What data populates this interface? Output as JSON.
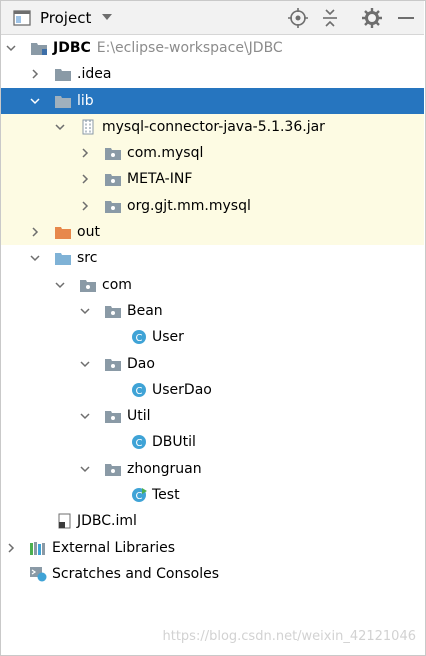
{
  "toolbar": {
    "title": "Project",
    "icons": [
      "project-view-icon",
      "dropdown-icon",
      "locate-icon",
      "collapse-icon",
      "settings-icon",
      "hide-icon"
    ]
  },
  "tree": {
    "root": {
      "name": "JDBC",
      "path": "E:\\eclipse-workspace\\JDBC"
    },
    "idea": ".idea",
    "lib": "lib",
    "jar": "mysql-connector-java-5.1.36.jar",
    "pkg_mysql": "com.mysql",
    "pkg_meta": "META-INF",
    "pkg_gjt": "org.gjt.mm.mysql",
    "out": "out",
    "src": "src",
    "com": "com",
    "bean": "Bean",
    "user": "User",
    "dao": "Dao",
    "userdao": "UserDao",
    "util": "Util",
    "dbutil": "DBUtil",
    "zhongruan": "zhongruan",
    "test": "Test",
    "iml": "JDBC.iml",
    "external": "External Libraries",
    "scratches": "Scratches and Consoles"
  },
  "colors": {
    "selection": "#2675bf",
    "jar_bg": "#fdfbe3",
    "folder": "#8a9aa6",
    "src_folder": "#7fb2d6",
    "out_folder": "#e7884b",
    "class_icon": "#3fa3d6"
  },
  "watermark": "https://blog.csdn.net/weixin_42121046"
}
